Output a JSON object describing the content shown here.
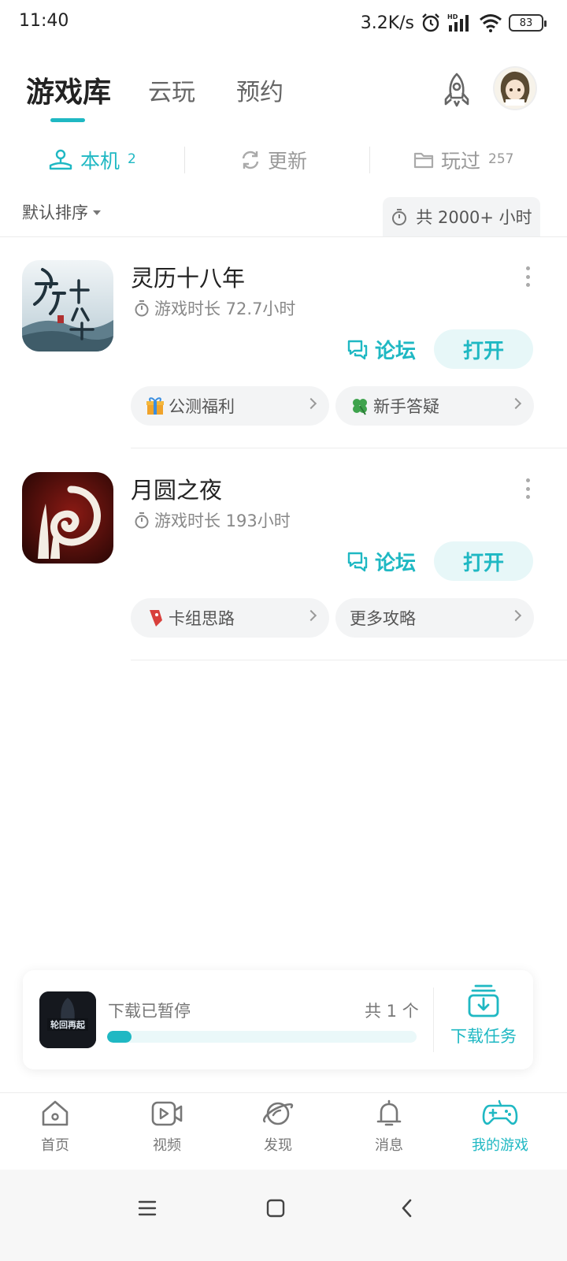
{
  "status_bar": {
    "time": "11:40",
    "speed": "3.2K/s",
    "battery": "83",
    "network": "HD"
  },
  "top_tabs": [
    {
      "label": "游戏库",
      "active": true
    },
    {
      "label": "云玩",
      "active": false
    },
    {
      "label": "预约",
      "active": false
    }
  ],
  "segments": [
    {
      "label": "本机",
      "count": "2",
      "icon": "joystick-icon",
      "active": true
    },
    {
      "label": "更新",
      "count": "",
      "icon": "refresh-icon",
      "active": false
    },
    {
      "label": "玩过",
      "count": "257",
      "icon": "folder-icon",
      "active": false
    }
  ],
  "sort": {
    "label": "默认排序",
    "total_time": "共 2000+ 小时"
  },
  "games": [
    {
      "name": "灵历十八年",
      "playtime": "游戏时长 72.7小时",
      "forum_label": "论坛",
      "open_label": "打开",
      "chips": [
        {
          "label": "公测福利",
          "icon": "gift-icon"
        },
        {
          "label": "新手答疑",
          "icon": "clover-icon"
        }
      ]
    },
    {
      "name": "月圆之夜",
      "playtime": "游戏时长 193小时",
      "forum_label": "论坛",
      "open_label": "打开",
      "chips": [
        {
          "label": "卡组思路",
          "icon": "bookmark-icon"
        },
        {
          "label": "更多攻略",
          "icon": ""
        }
      ]
    }
  ],
  "download": {
    "status": "下载已暂停",
    "count": "共 1 个",
    "progress": 0.08,
    "task_label": "下载任务",
    "thumb_text": "轮回再起"
  },
  "bottom_nav": [
    {
      "label": "首页",
      "icon": "home-icon",
      "active": false
    },
    {
      "label": "视频",
      "icon": "video-icon",
      "active": false
    },
    {
      "label": "发现",
      "icon": "planet-icon",
      "active": false
    },
    {
      "label": "消息",
      "icon": "bell-icon",
      "active": false
    },
    {
      "label": "我的游戏",
      "icon": "gamepad-icon",
      "active": true
    }
  ],
  "colors": {
    "accent": "#1fb8c3",
    "accent_light": "#e7f7f8",
    "text": "#222222",
    "muted": "#888888"
  }
}
